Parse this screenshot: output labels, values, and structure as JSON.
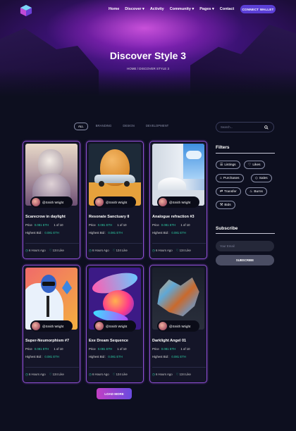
{
  "header": {
    "nav": [
      "Home",
      "Discover ▾",
      "Activity",
      "Community ▾",
      "Pages ▾",
      "Contact"
    ],
    "connect_label": "CONNECT WALLET"
  },
  "hero": {
    "title": "Discover Style 3",
    "breadcrumb": "HOME  /  DISCOVER STYLE 3"
  },
  "tabs": [
    "ALL",
    "BRANDING",
    "DESIGN",
    "DEVELOPMENT"
  ],
  "cards": [
    {
      "title": "Scarecrow in daylight",
      "owner": "@Smith Wright",
      "price_label": "Price",
      "price": "0.081 ETH",
      "edition": "1 of 10",
      "bid_label": "Highest Bid :",
      "bid": "0.081 ETH",
      "time": "6 Hours Ago",
      "likes": "134 Like"
    },
    {
      "title": "Resonate Sanctuary II",
      "owner": "@Smith Wright",
      "price_label": "Price",
      "price": "0.081 ETH",
      "edition": "1 of 10",
      "bid_label": "Highest Bid :",
      "bid": "0.081 ETH",
      "time": "6 Hours Ago",
      "likes": "134 Like"
    },
    {
      "title": "Analogue refraction #3",
      "owner": "@Smith Wright",
      "price_label": "Price",
      "price": "0.081 ETH",
      "edition": "1 of 10",
      "bid_label": "Highest Bid :",
      "bid": "0.081 ETH",
      "time": "6 Hours Ago",
      "likes": "134 Like"
    },
    {
      "title": "Super-Neumorphism #7",
      "owner": "@Smith Wright",
      "price_label": "Price",
      "price": "0.081 ETH",
      "edition": "1 of 10",
      "bid_label": "Highest Bid :",
      "bid": "0.081 ETH",
      "time": "6 Hours Ago",
      "likes": "134 Like"
    },
    {
      "title": "Exe Dream Sequence",
      "owner": "@Smith Wright",
      "price_label": "Price",
      "price": "0.081 ETH",
      "edition": "1 of 10",
      "bid_label": "Highest Bid :",
      "bid": "0.081 ETH",
      "time": "6 Hours Ago",
      "likes": "134 Like"
    },
    {
      "title": "Darklight Angel 01",
      "owner": "@Smith Wright",
      "price_label": "Price",
      "price": "0.081 ETH",
      "edition": "1 of 10",
      "bid_label": "Highest Bid :",
      "bid": "0.081 ETH",
      "time": "6 Hours Ago",
      "likes": "134 Like"
    }
  ],
  "load_more": "LOAD MORE",
  "sidebar": {
    "search_placeholder": "Search...",
    "filters_title": "Filters",
    "filters": [
      "Listings",
      "Likes",
      "Purchases",
      "Sales",
      "Transfer",
      "Burns",
      "Bids"
    ],
    "subscribe_title": "Subscribe",
    "email_placeholder": "Your Email",
    "subscribe_button": "SUBSCRIBE"
  },
  "colors": {
    "accent": "#5b3fd6",
    "eth": "#2fd0a6",
    "card_border": "#8d4fd4",
    "background": "#0d0f1f"
  }
}
